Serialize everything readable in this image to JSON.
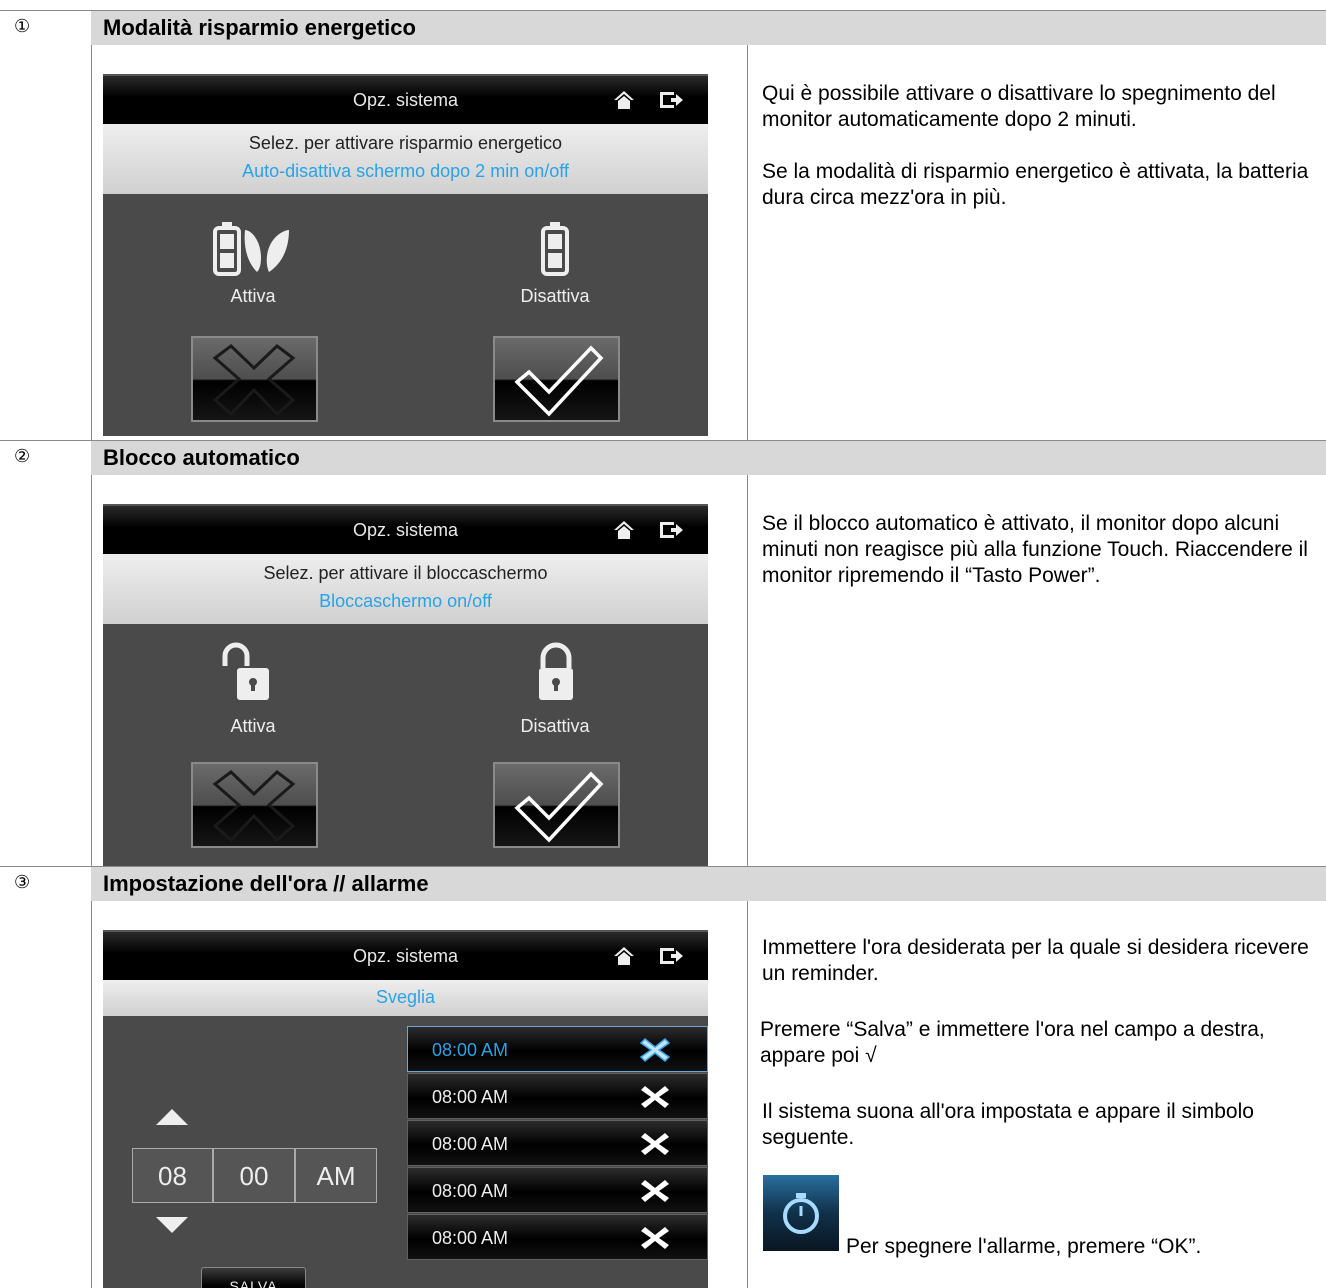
{
  "sections": [
    {
      "number": "①",
      "title": "Modalità risparmio energetico",
      "screen": {
        "title": "Opz. sistema",
        "band_line1": "Selez. per attivare risparmio energetico",
        "band_line2": "Auto-disattiva schermo dopo 2 min on/off",
        "option_left": "Attiva",
        "option_right": "Disattiva"
      },
      "description": [
        "Qui è possibile attivare o disattivare lo spegnimento del monitor automaticamente dopo 2 minuti.",
        "Se la modalità di risparmio energetico è attivata, la batteria dura circa mezz'ora in più."
      ]
    },
    {
      "number": "②",
      "title": "Blocco automatico",
      "screen": {
        "title": "Opz. sistema",
        "band_line1": "Selez. per attivare il bloccaschermo",
        "band_line2": "Bloccaschermo on/off",
        "option_left": "Attiva",
        "option_right": "Disattiva"
      },
      "description": [
        "Se il blocco automatico è attivato, il monitor dopo alcuni minuti non reagisce più alla funzione Touch. Riaccendere il monitor ripremendo il “Tasto Power”."
      ]
    },
    {
      "number": "③",
      "title": "Impostazione dell'ora // allarme",
      "screen": {
        "title": "Opz. sistema",
        "band_line2": "Sveglia",
        "hour": "08",
        "minute": "00",
        "ampm": "AM",
        "save_label": "SALVA",
        "alarms": [
          "08:00 AM",
          "08:00 AM",
          "08:00 AM",
          "08:00 AM",
          "08:00 AM"
        ]
      },
      "description": [
        "Immettere l'ora desiderata per la quale si desidera ricevere un reminder.",
        "Premere “Salva” e immettere l'ora nel campo a destra, appare poi √",
        "Il sistema suona all'ora impostata e appare il simbolo seguente.",
        "Per spegnere l'allarme, premere “OK”."
      ]
    }
  ],
  "colors": {
    "accent": "#29a3e6",
    "header_bg": "#d8d8d8",
    "screen_bg": "#4a4a4a"
  }
}
